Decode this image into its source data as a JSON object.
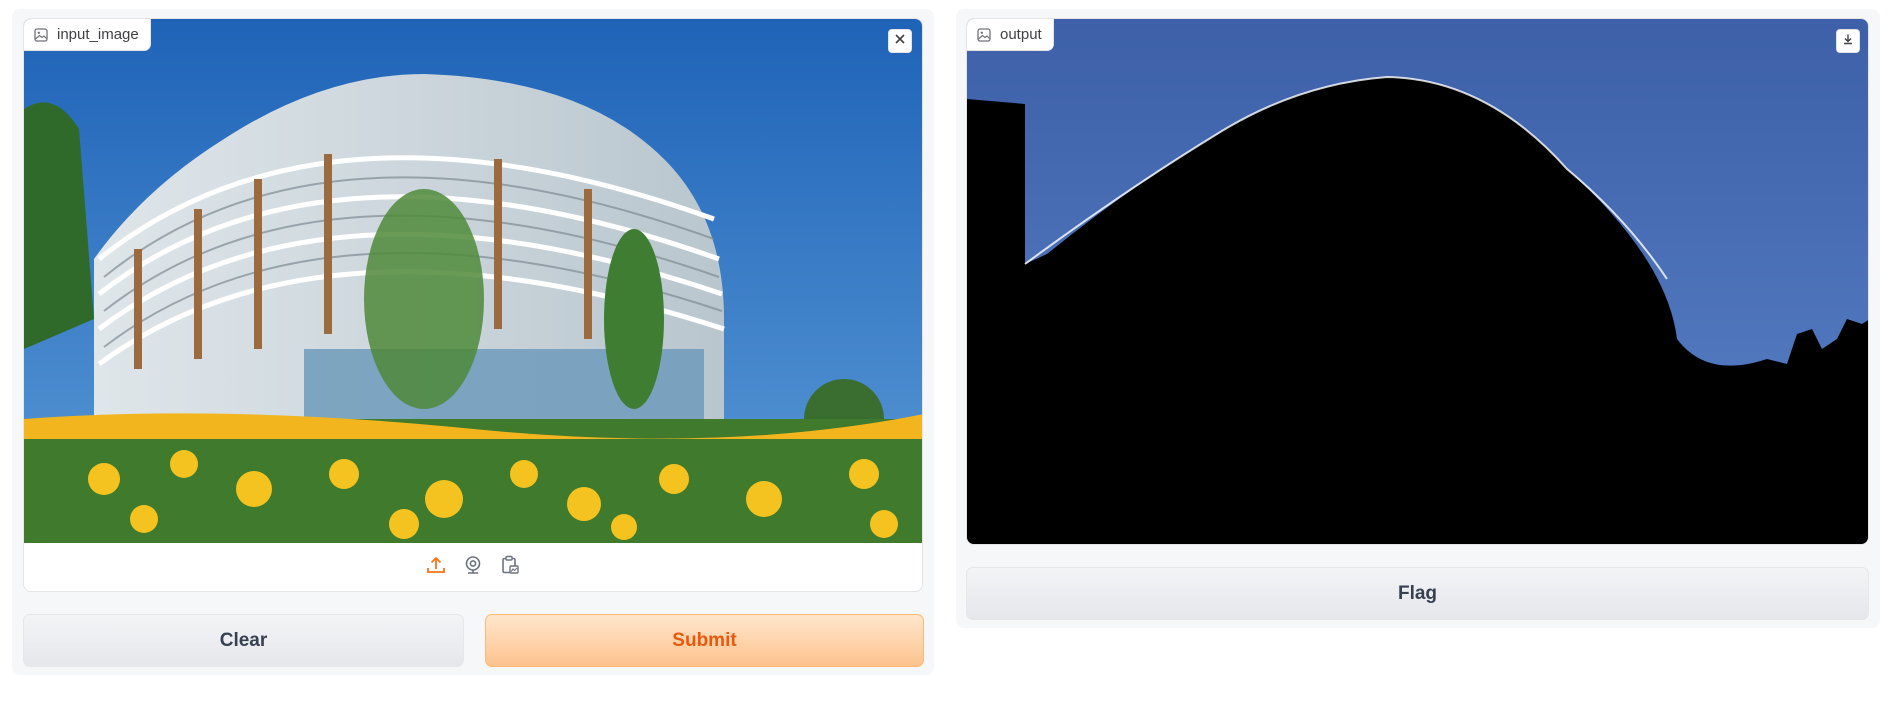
{
  "input": {
    "label": "input_image",
    "clear_tooltip": "Clear",
    "sources": [
      "upload",
      "webcam",
      "clipboard"
    ]
  },
  "output": {
    "label": "output"
  },
  "buttons": {
    "clear": "Clear",
    "submit": "Submit",
    "flag": "Flag"
  },
  "colors": {
    "accent": "#f97316",
    "submit_text": "#ea580c",
    "submit_bg_top": "#ffe6cc",
    "submit_bg_bottom": "#fdc38e",
    "sky": "#3c7cc4",
    "mask_sky": "#4a6ab0"
  }
}
